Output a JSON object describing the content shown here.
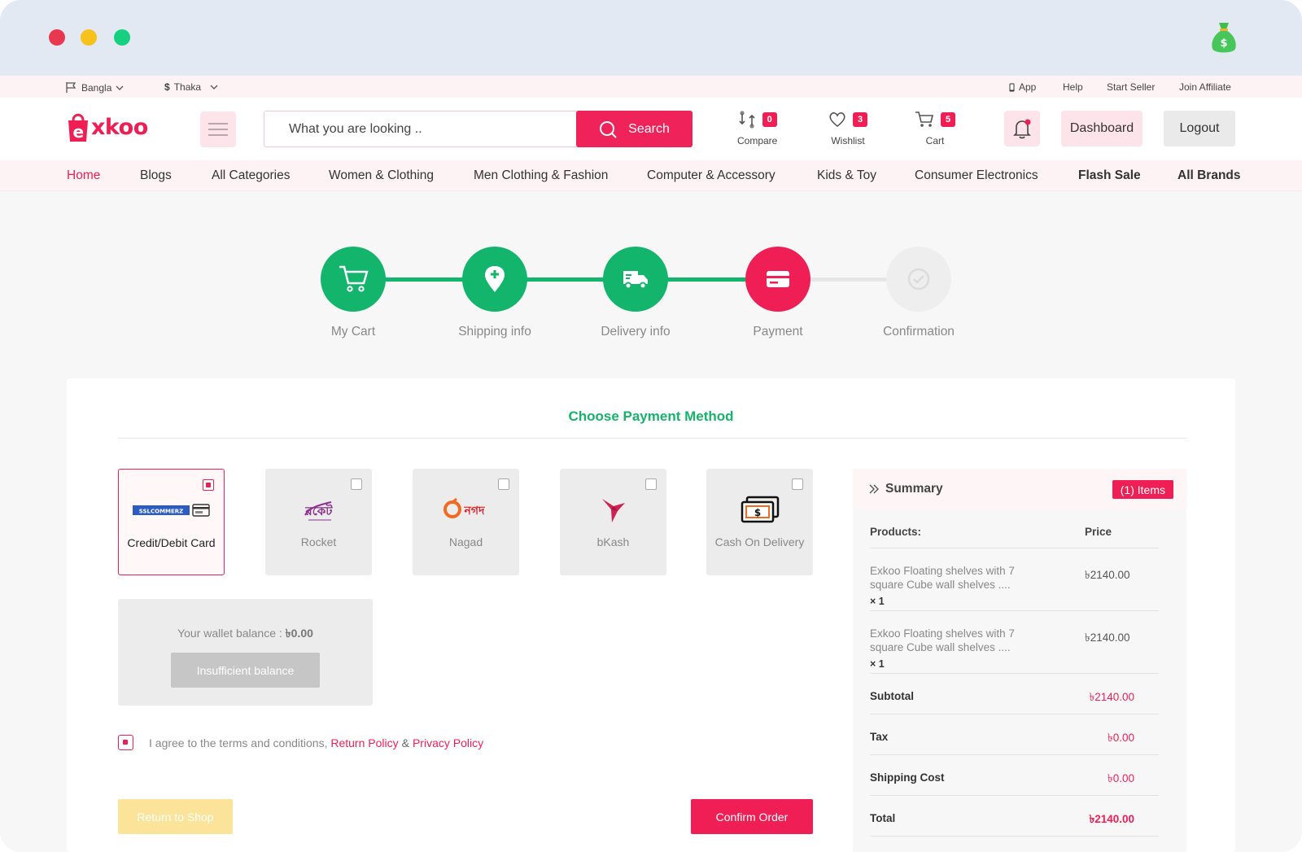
{
  "topbar": {
    "language": "Bangla",
    "currency": "Thaka",
    "links": [
      "App",
      "Help",
      "Start Seller",
      "Join Affiliate"
    ]
  },
  "header": {
    "logo_text": "xkoo",
    "search_placeholder": "What you are looking ..",
    "search_label": "Search",
    "compare": {
      "label": "Compare",
      "count": "0"
    },
    "wishlist": {
      "label": "Wishlist",
      "count": "3"
    },
    "cart": {
      "label": "Cart",
      "count": "5"
    },
    "dashboard_label": "Dashboard",
    "logout_label": "Logout"
  },
  "nav": [
    "Home",
    "Blogs",
    "All Categories",
    "Women & Clothing",
    "Men Clothing & Fashion",
    "Computer & Accessory",
    "Kids & Toy",
    "Consumer Electronics",
    "Flash Sale",
    "All Brands"
  ],
  "steps": [
    {
      "label": "My Cart",
      "state": "done"
    },
    {
      "label": "Shipping info",
      "state": "done"
    },
    {
      "label": "Delivery info",
      "state": "done"
    },
    {
      "label": "Payment",
      "state": "active"
    },
    {
      "label": "Confirmation",
      "state": "pending"
    }
  ],
  "payment": {
    "title": "Choose Payment Method",
    "methods": [
      {
        "name": "Credit/Debit Card",
        "logo": "SSLCOMMERZ",
        "selected": true
      },
      {
        "name": "Rocket",
        "logo": "রকেট",
        "selected": false
      },
      {
        "name": "Nagad",
        "logo": "নগদ",
        "selected": false
      },
      {
        "name": "bKash",
        "logo": "bkash-bird",
        "selected": false
      },
      {
        "name": "Cash On Delivery",
        "logo": "cash-icon",
        "selected": false
      }
    ],
    "wallet_label": "Your wallet balance :",
    "wallet_amount": "৳0.00",
    "insufficient_label": "Insufficient balance",
    "agree_text": "I agree to the terms and conditions,",
    "return_policy": "Return Policy",
    "amp": "&",
    "privacy_policy": "Privacy Policy",
    "return_button": "Return to Shop",
    "confirm_button": "Confirm Order"
  },
  "summary": {
    "title": "Summary",
    "items_badge": "(1) Items",
    "col_products": "Products:",
    "col_price": "Price",
    "products": [
      {
        "name": "Exkoo Floating shelves with 7 square Cube wall shelves ....",
        "qty": "× 1",
        "price": "৳2140.00"
      },
      {
        "name": "Exkoo Floating shelves with 7 square Cube wall shelves ....",
        "qty": "× 1",
        "price": "৳2140.00"
      }
    ],
    "subtotal_label": "Subtotal",
    "subtotal": "৳2140.00",
    "tax_label": "Tax",
    "tax": "৳0.00",
    "shipping_label": "Shipping Cost",
    "shipping": "৳0.00",
    "total_label": "Total",
    "total": "৳2140.00"
  },
  "colors": {
    "brand": "#ef1e55",
    "success": "#16b36b",
    "step_done": "#13b56c"
  }
}
